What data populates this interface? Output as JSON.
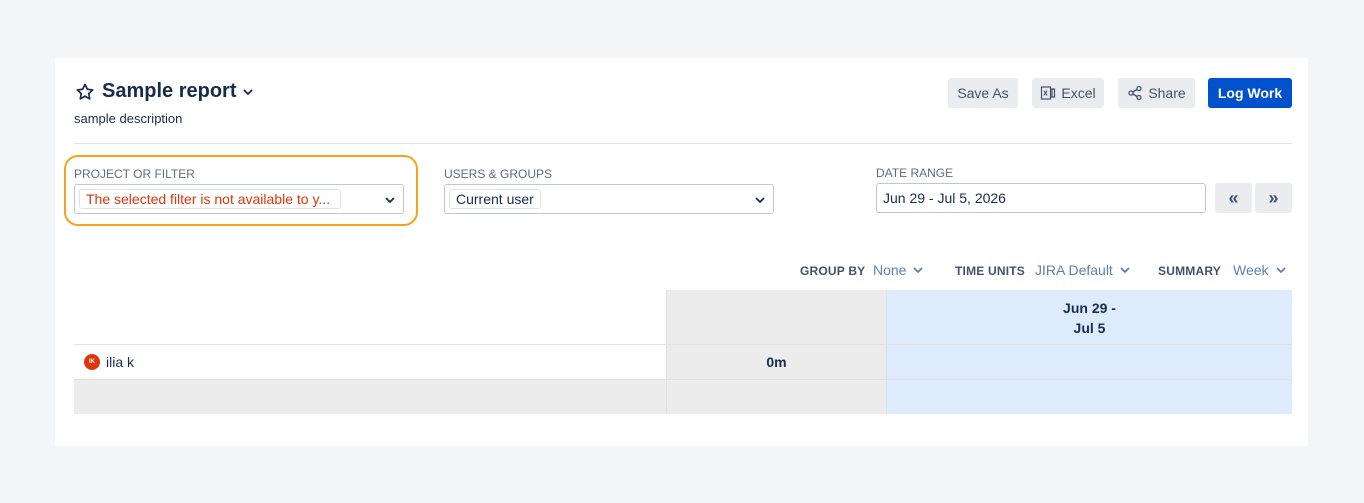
{
  "report": {
    "title": "Sample report",
    "description": "sample description"
  },
  "toolbar": {
    "save_as_label": "Save As",
    "excel_label": "Excel",
    "share_label": "Share",
    "log_work_label": "Log Work"
  },
  "filters": {
    "project_label": "PROJECT OR FILTER",
    "project_value": "The selected filter is not available to y...",
    "users_label": "USERS & GROUPS",
    "users_value": "Current user",
    "date_label": "DATE RANGE",
    "date_value": "Jun 29 - Jul 5, 2026",
    "prev_label": "«",
    "next_label": "»"
  },
  "options": {
    "group_by_label": "GROUP BY",
    "group_by_value": "None",
    "time_units_label": "TIME UNITS",
    "time_units_value": "JIRA Default",
    "summary_label": "SUMMARY",
    "summary_value": "Week"
  },
  "table": {
    "period_header_line1": "Jun 29 -",
    "period_header_line2": "Jul 5",
    "rows": [
      {
        "avatar_initials": "IK",
        "name": "ilia k",
        "total": "0m"
      }
    ]
  },
  "colors": {
    "primary": "#0052cc",
    "error": "#de350b",
    "highlight": "#f5a31a",
    "week_column": "#deebfd"
  },
  "icons": [
    "star-icon",
    "chevron-down-icon",
    "excel-icon",
    "share-icon"
  ]
}
